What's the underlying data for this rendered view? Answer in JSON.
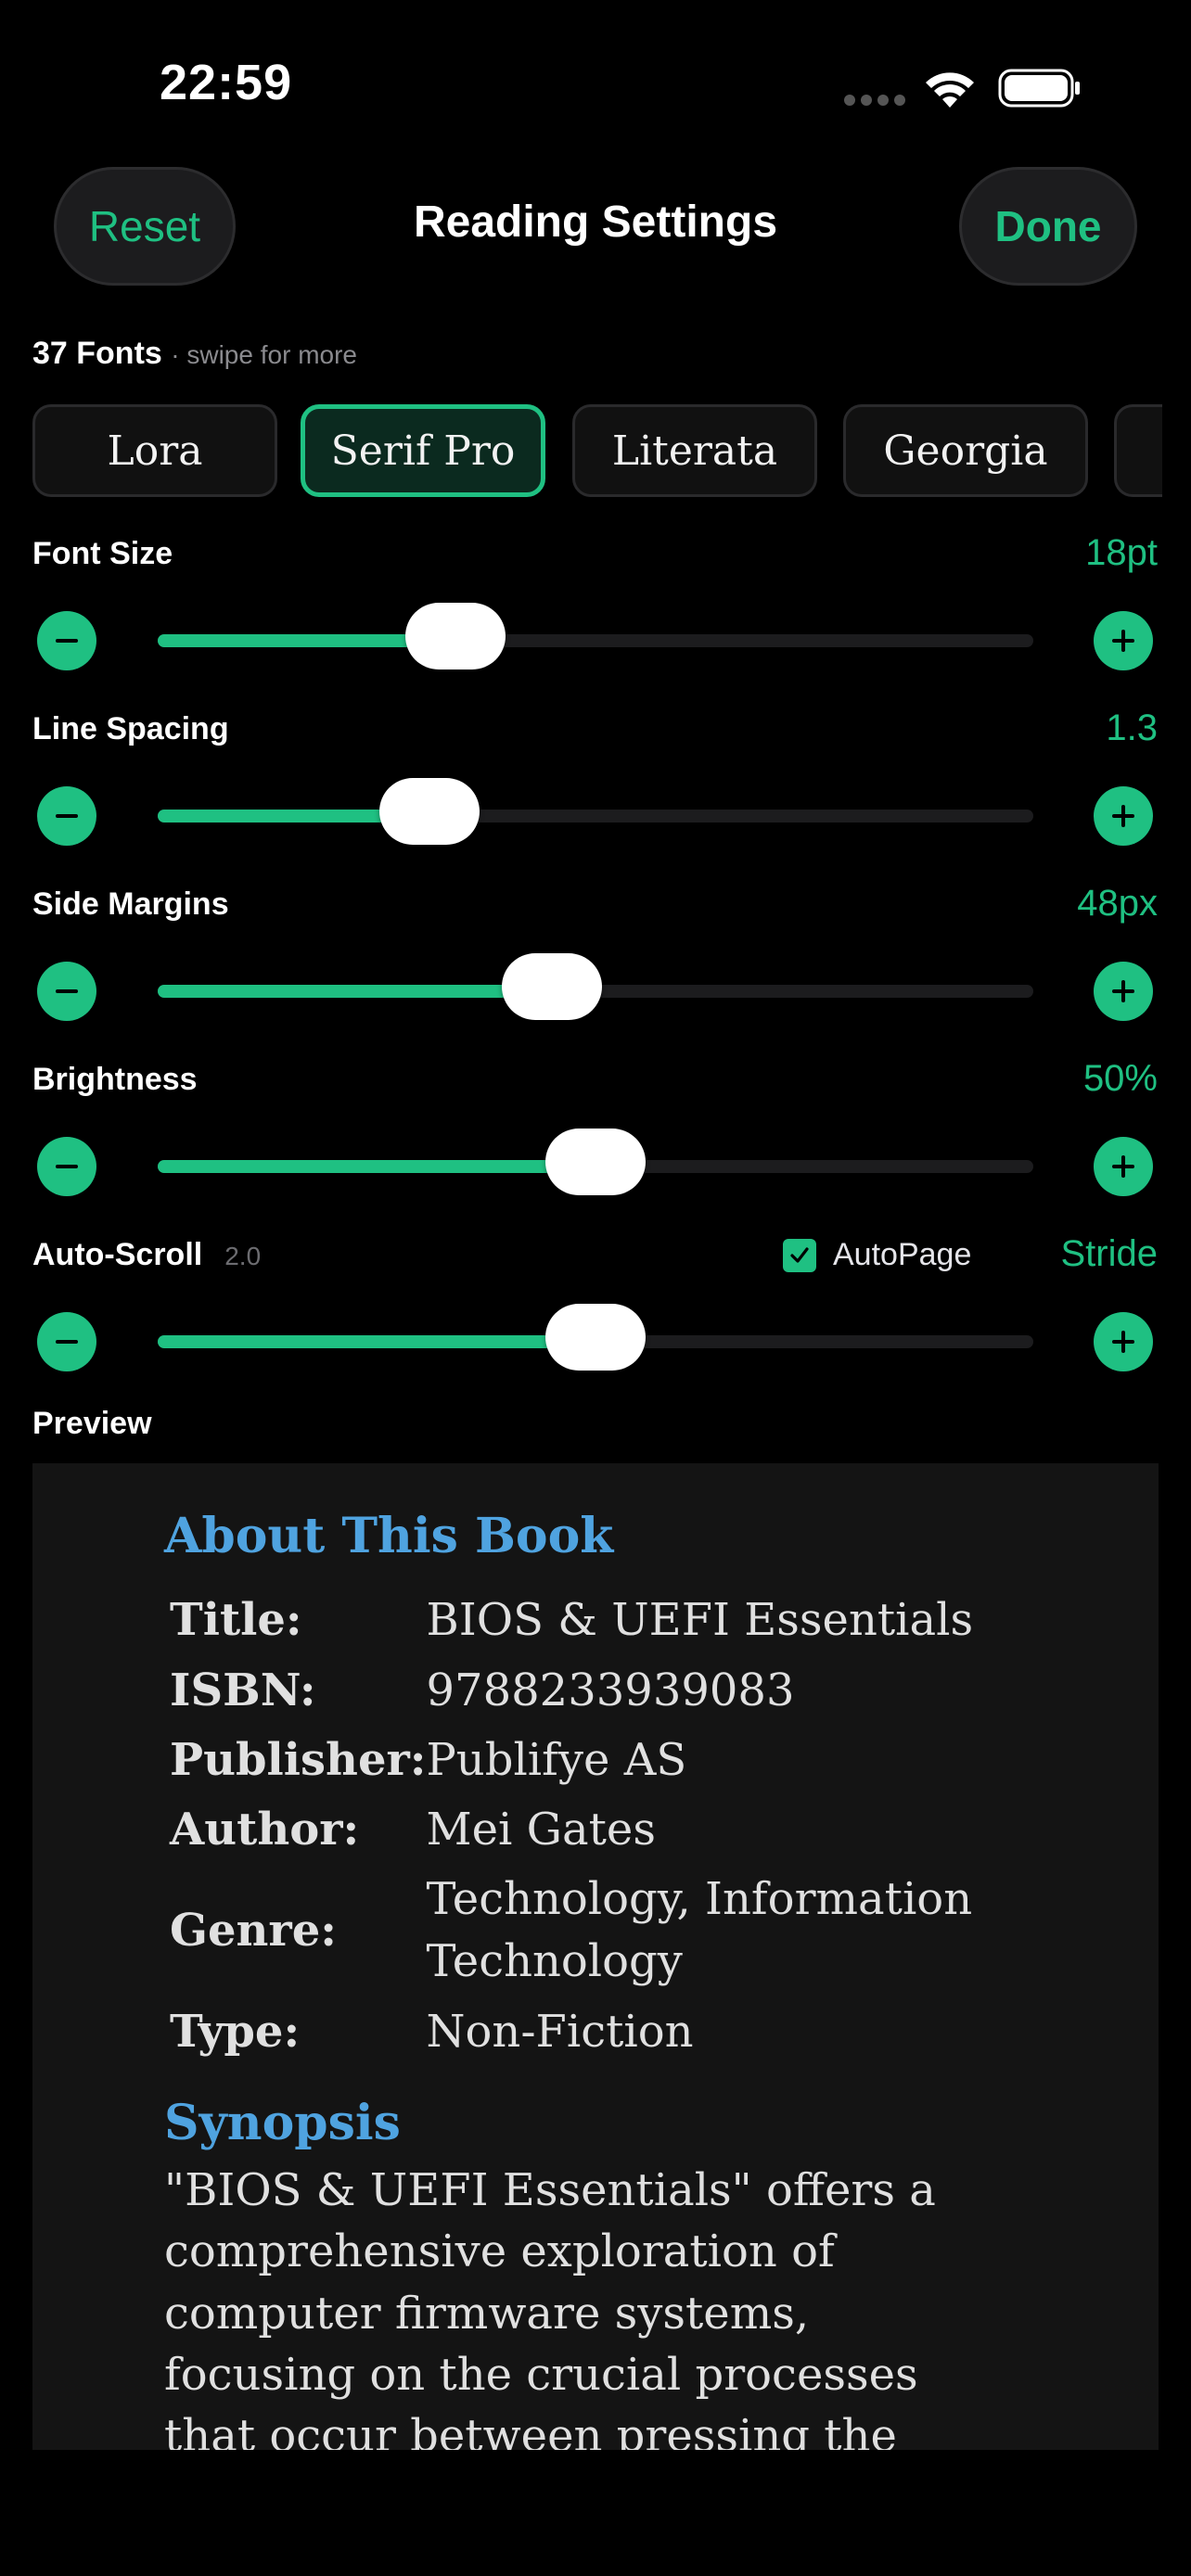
{
  "status_bar": {
    "time": "22:59"
  },
  "header": {
    "reset_label": "Reset",
    "title": "Reading Settings",
    "done_label": "Done"
  },
  "fonts": {
    "count_label": "37 Fonts",
    "hint": "· swipe for more",
    "chips": [
      "Lora",
      "Serif Pro",
      "Literata",
      "Georgia"
    ],
    "selected": "Serif Pro"
  },
  "settings": {
    "font_size": {
      "label": "Font Size",
      "value": "18pt",
      "fraction": 0.34
    },
    "line_spacing": {
      "label": "Line Spacing",
      "value": "1.3",
      "fraction": 0.31
    },
    "side_margins": {
      "label": "Side Margins",
      "value": "48px",
      "fraction": 0.45
    },
    "brightness": {
      "label": "Brightness",
      "value": "50%",
      "fraction": 0.5
    },
    "auto_scroll": {
      "label": "Auto-Scroll",
      "sub_value": "2.0",
      "autopage_label": "AutoPage",
      "autopage_checked": true,
      "mode": "Stride",
      "fraction": 0.5
    }
  },
  "preview": {
    "label": "Preview",
    "about_heading": "About This Book",
    "meta": [
      {
        "key": "Title:",
        "value": "BIOS & UEFI Essentials"
      },
      {
        "key": "ISBN:",
        "value": "9788233939083"
      },
      {
        "key": "Publisher:",
        "value": "Publifye AS"
      },
      {
        "key": "Author:",
        "value": "Mei Gates"
      },
      {
        "key": "Genre:",
        "value": "Technology, Information Technology"
      },
      {
        "key": "Type:",
        "value": "Non-Fiction"
      }
    ],
    "synopsis_heading": "Synopsis",
    "synopsis": "\"BIOS & UEFI Essentials\" offers a comprehensive exploration of computer firmware systems, focusing on the crucial processes that occur between pressing the"
  },
  "colors": {
    "accent": "#1fc082",
    "heading_blue": "#4fa3e0",
    "background": "#000000",
    "panel": "#141414"
  }
}
